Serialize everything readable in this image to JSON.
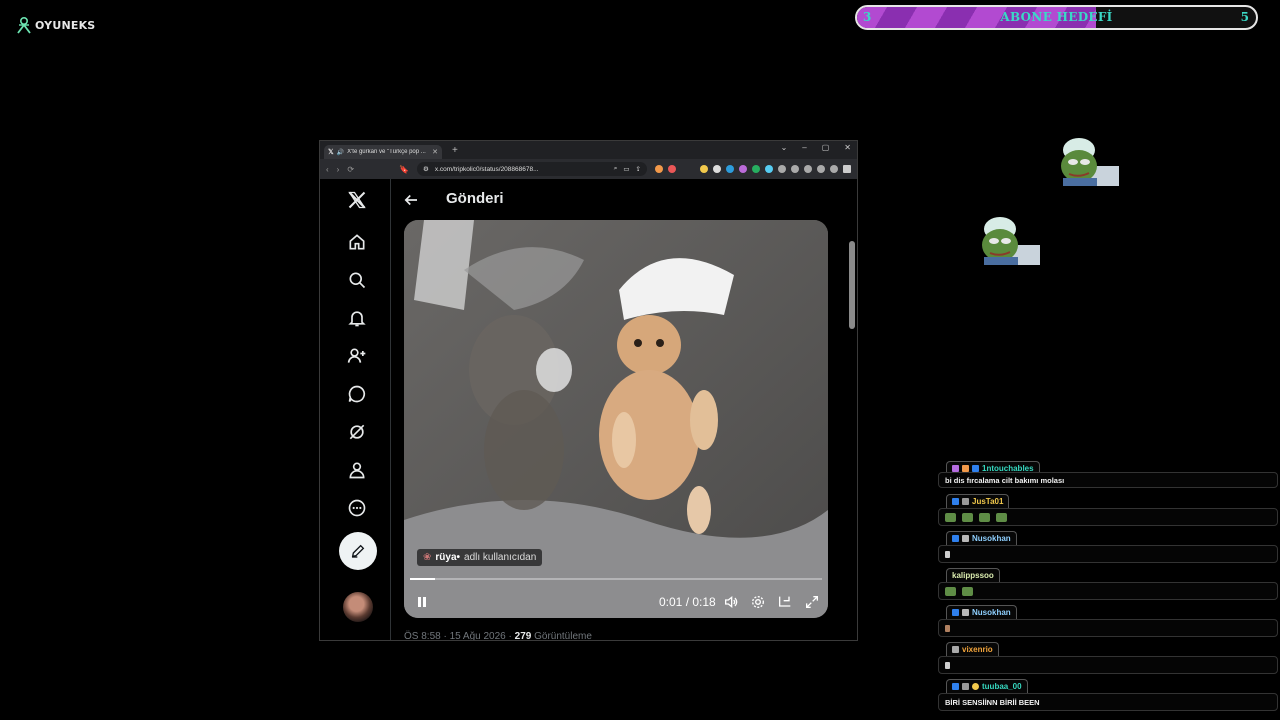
{
  "logo": {
    "text": "OYUNEKS",
    "subtext": ""
  },
  "goal": {
    "title": "ABONE HEDEFİ",
    "current": "3",
    "target": "5",
    "progress": 0.6
  },
  "browser": {
    "tab_title": "X'te gürkan ve \"Türkçe pop ...",
    "url": "x.com/tripkolic0/status/208868678...",
    "window_controls": [
      "⌄",
      "–",
      "▢",
      "✕"
    ]
  },
  "x": {
    "header_title": "Gönderi",
    "nav_icons": [
      "home-icon",
      "search-icon",
      "bell-icon",
      "follow-icon",
      "chat-icon",
      "grok-icon",
      "profile-icon",
      "more-icon"
    ],
    "video": {
      "credit_user": "rüya•",
      "credit_suffix": "adlı kullanıcıdan",
      "time": "0:01 / 0:18",
      "progress": 0.06
    },
    "meta": {
      "time": "ÖS 8:58 · 15 Ağu 2026 · ",
      "views_count": "279",
      "views_label": " Görüntüleme"
    }
  },
  "chat": {
    "messages": [
      {
        "user": "1ntouchables",
        "color": "#36d9c0",
        "text": "bi dis fırcalama cilt bakımı molası"
      },
      {
        "user": "JusTa01",
        "color": "#f2c94c",
        "text": ""
      },
      {
        "user": "Nusokhan",
        "color": "#8fd0ff",
        "text": ""
      },
      {
        "user": "kalippssoo",
        "color": "#dcedb0",
        "text": ""
      },
      {
        "user": "Nusokhan",
        "color": "#8fd0ff",
        "text": ""
      },
      {
        "user": "vixenrio",
        "color": "#f2a43b",
        "text": ""
      },
      {
        "user": "tuubaa_00",
        "color": "#36d9c0",
        "text": "BİRİ SENSİİNN BİRİİ BEEN"
      }
    ]
  },
  "colors": {
    "accent_purple": "#b24ad1",
    "goal_text": "#3ad9c6",
    "x_bg": "#000000"
  }
}
